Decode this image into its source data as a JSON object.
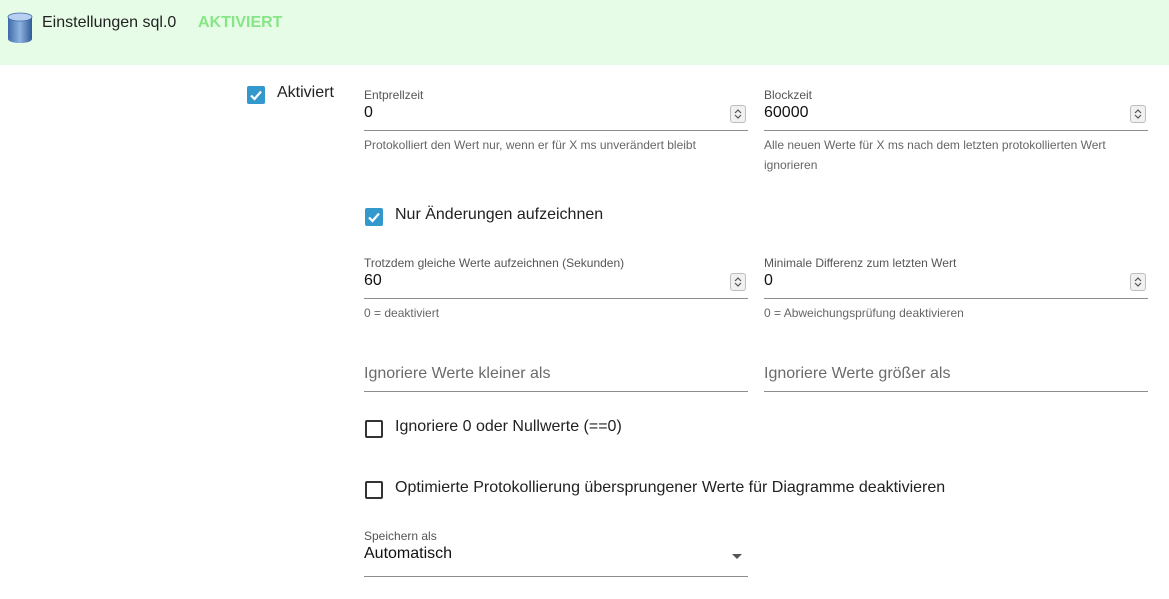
{
  "header": {
    "title": "Einstellungen sql.0",
    "status": "AKTIVIERT",
    "icon": "database-icon"
  },
  "enabled": {
    "label": "Aktiviert",
    "checked": true
  },
  "debounce": {
    "label": "Entprellzeit",
    "value": "0",
    "helper": "Protokolliert den Wert nur, wenn er für X ms unverändert bleibt"
  },
  "blocktime": {
    "label": "Blockzeit",
    "value": "60000",
    "helper": "Alle neuen Werte für X ms nach dem letzten protokollierten Wert ignorieren"
  },
  "changes_only": {
    "label": "Nur Änderungen aufzeichnen",
    "checked": true
  },
  "same_values": {
    "label": "Trotzdem gleiche Werte aufzeichnen (Sekunden)",
    "value": "60",
    "helper": "0 = deaktiviert"
  },
  "min_diff": {
    "label": "Minimale Differenz zum letzten Wert",
    "value": "0",
    "helper": "0 = Abweichungsprüfung deaktivieren"
  },
  "ignore_below": {
    "placeholder": "Ignoriere Werte kleiner als"
  },
  "ignore_above": {
    "placeholder": "Ignoriere Werte größer als"
  },
  "ignore_zero": {
    "label": "Ignoriere 0 oder Nullwerte (==0)",
    "checked": false
  },
  "disable_optimized": {
    "label": "Optimierte Protokollierung übersprungener Werte für Diagramme deaktivieren",
    "checked": false
  },
  "store_as": {
    "label": "Speichern als",
    "value": "Automatisch"
  }
}
